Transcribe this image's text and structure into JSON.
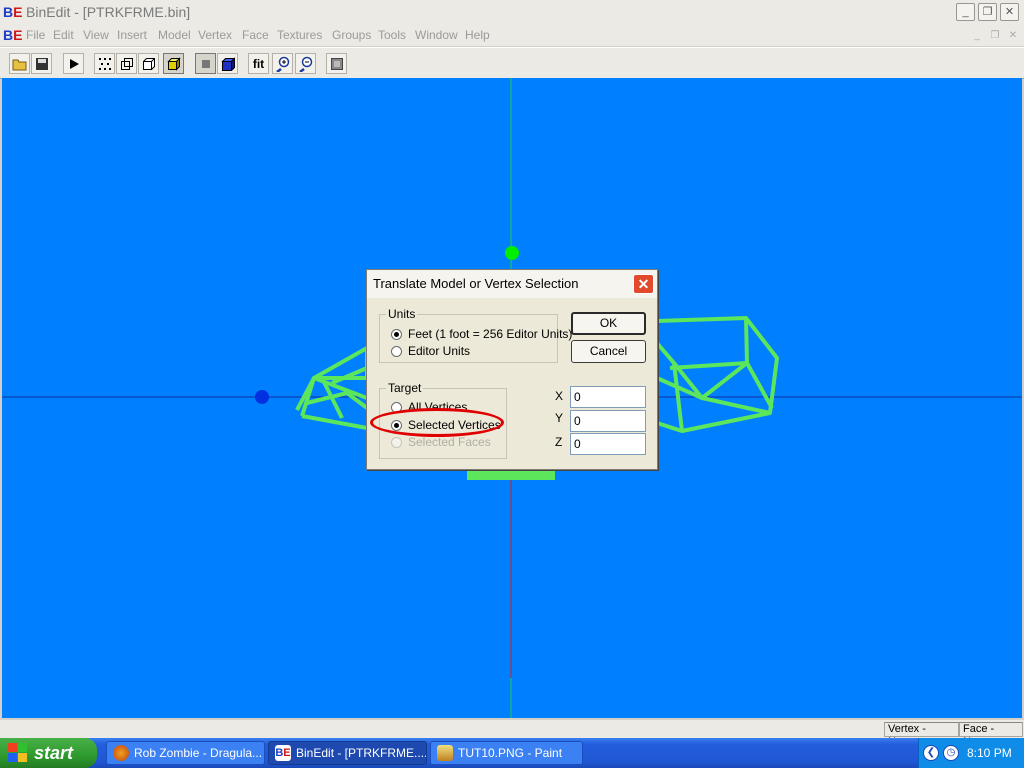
{
  "window": {
    "title": "BinEdit - [PTRKFRME.bin]",
    "minimize": "_",
    "maximize": "❐",
    "close": "✕",
    "logo_b": "B",
    "logo_e": "E"
  },
  "menu": {
    "items": [
      "File",
      "Edit",
      "View",
      "Insert",
      "Model",
      "Vertex",
      "Face",
      "Textures",
      "Groups",
      "Tools",
      "Window",
      "Help"
    ],
    "mdi_min": "_",
    "mdi_restore": "❐",
    "mdi_close": "✕"
  },
  "toolbar": {
    "fit_label": "fit"
  },
  "dialog": {
    "title": "Translate Model or Vertex Selection",
    "close": "✕",
    "units_group": "Units",
    "units_feet": "Feet (1 foot = 256 Editor Units)",
    "units_editor": "Editor Units",
    "target_group": "Target",
    "target_all": "All Vertices",
    "target_selected": "Selected Vertices",
    "target_faces": "Selected Faces",
    "ok": "OK",
    "cancel": "Cancel",
    "x_label": "X",
    "y_label": "Y",
    "z_label": "Z",
    "x_value": "0",
    "y_value": "0",
    "z_value": "0"
  },
  "status": {
    "vertex": "Vertex - None",
    "face": "Face - None"
  },
  "taskbar": {
    "start": "start",
    "tasks": [
      "Rob Zombie - Dragula...",
      "BinEdit - [PTRKFRME....",
      "TUT10.PNG - Paint"
    ],
    "clock": "8:10 PM"
  },
  "colors": {
    "viewport": "#0080ff",
    "wireframe": "#5ce65c",
    "annotation": "#e00000"
  }
}
